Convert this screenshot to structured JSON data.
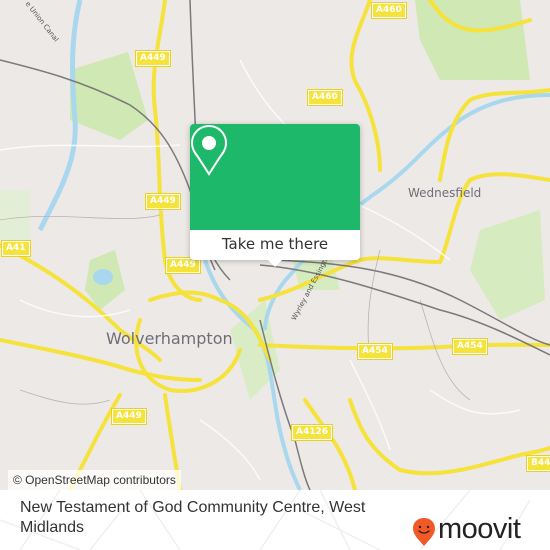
{
  "map": {
    "road_labels": [
      {
        "id": "a460-top",
        "text": "A460"
      },
      {
        "id": "a449-top",
        "text": "A449"
      },
      {
        "id": "a460-mid",
        "text": "A460"
      },
      {
        "id": "a449-mid",
        "text": "A449"
      },
      {
        "id": "a41",
        "text": "A41"
      },
      {
        "id": "a449-centre",
        "text": "A449"
      },
      {
        "id": "a454-left",
        "text": "A454"
      },
      {
        "id": "a454-right",
        "text": "A454"
      },
      {
        "id": "a449-south",
        "text": "A449"
      },
      {
        "id": "a4126",
        "text": "A4126"
      },
      {
        "id": "b44",
        "text": "B44"
      }
    ],
    "place_labels": {
      "wolverhampton": "Wolverhampton",
      "wednesfield": "Wednesfield",
      "canal": "e Union Canal",
      "wyrley": "Wyrley and Essington"
    },
    "colors": {
      "land": "#ede9e6",
      "park": "#cfe8b4",
      "water": "#a9d8ee",
      "road_major": "#f5e23a",
      "railway": "#7a7a7a"
    }
  },
  "popup": {
    "icon": "map-pin-icon",
    "button_label": "Take me there",
    "color": "#1eb86a"
  },
  "attribution": "© OpenStreetMap contributors",
  "footer": {
    "title": "New Testament of God Community Centre, West Midlands",
    "logo_text": "moovit",
    "logo_icon": "moovit-smile-pin-icon",
    "logo_color": "#f05a28"
  }
}
